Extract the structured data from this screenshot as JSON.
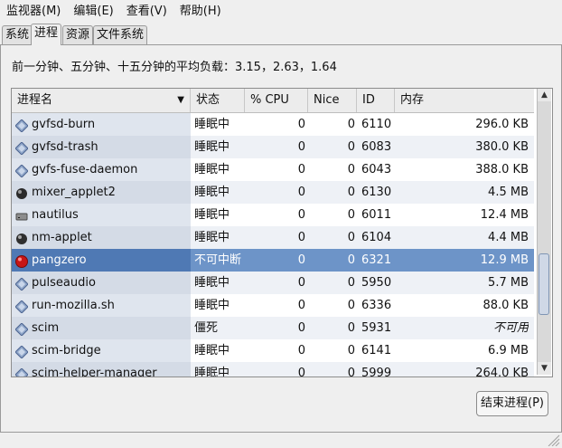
{
  "menubar": {
    "items": [
      {
        "label": "监视器(M)"
      },
      {
        "label": "编辑(E)"
      },
      {
        "label": "查看(V)"
      },
      {
        "label": "帮助(H)"
      }
    ]
  },
  "tabs": [
    {
      "label": "系统"
    },
    {
      "label": "进程"
    },
    {
      "label": "资源"
    },
    {
      "label": "文件系统"
    }
  ],
  "load_average": {
    "text": "前一分钟、五分钟、十五分钟的平均负载：3.15，2.63，1.64"
  },
  "table": {
    "columns": [
      {
        "label": "进程名"
      },
      {
        "label": "状态"
      },
      {
        "label": "% CPU"
      },
      {
        "label": "Nice"
      },
      {
        "label": "ID"
      },
      {
        "label": "内存"
      }
    ],
    "rows": [
      {
        "name": "gvfsd-burn",
        "state": "睡眠中",
        "cpu": "0",
        "nice": "0",
        "id": "6110",
        "mem": "296.0 KB",
        "icon": "diamond-process-icon"
      },
      {
        "name": "gvfsd-trash",
        "state": "睡眠中",
        "cpu": "0",
        "nice": "0",
        "id": "6083",
        "mem": "380.0 KB",
        "icon": "diamond-process-icon"
      },
      {
        "name": "gvfs-fuse-daemon",
        "state": "睡眠中",
        "cpu": "0",
        "nice": "0",
        "id": "6043",
        "mem": "388.0 KB",
        "icon": "diamond-process-icon"
      },
      {
        "name": "mixer_applet2",
        "state": "睡眠中",
        "cpu": "0",
        "nice": "0",
        "id": "6130",
        "mem": "4.5 MB",
        "icon": "speaker-icon"
      },
      {
        "name": "nautilus",
        "state": "睡眠中",
        "cpu": "0",
        "nice": "0",
        "id": "6011",
        "mem": "12.4 MB",
        "icon": "drive-icon"
      },
      {
        "name": "nm-applet",
        "state": "睡眠中",
        "cpu": "0",
        "nice": "0",
        "id": "6104",
        "mem": "4.4 MB",
        "icon": "network-icon"
      },
      {
        "name": "pangzero",
        "state": "不可中断",
        "cpu": "0",
        "nice": "0",
        "id": "6321",
        "mem": "12.9 MB",
        "icon": "red-ball-icon"
      },
      {
        "name": "pulseaudio",
        "state": "睡眠中",
        "cpu": "0",
        "nice": "0",
        "id": "5950",
        "mem": "5.7 MB",
        "icon": "diamond-process-icon"
      },
      {
        "name": "run-mozilla.sh",
        "state": "睡眠中",
        "cpu": "0",
        "nice": "0",
        "id": "6336",
        "mem": "88.0 KB",
        "icon": "diamond-process-icon"
      },
      {
        "name": "scim",
        "state": "僵死",
        "cpu": "0",
        "nice": "0",
        "id": "5931",
        "mem": "不可用",
        "icon": "diamond-process-icon"
      },
      {
        "name": "scim-bridge",
        "state": "睡眠中",
        "cpu": "0",
        "nice": "0",
        "id": "6141",
        "mem": "6.9 MB",
        "icon": "diamond-process-icon"
      },
      {
        "name": "scim-helper-manager",
        "state": "睡眠中",
        "cpu": "0",
        "nice": "0",
        "id": "5999",
        "mem": "264.0 KB",
        "icon": "diamond-process-icon"
      }
    ],
    "selected_row": "pangzero"
  },
  "scrollbar": {
    "up_icon": "scroll-up-arrow-icon",
    "down_icon": "scroll-down-arrow-icon"
  },
  "end_process_button": {
    "label": "结束进程(P)"
  },
  "colors": {
    "selection": "#6d94c8",
    "name_column": "#dfe5ee"
  }
}
